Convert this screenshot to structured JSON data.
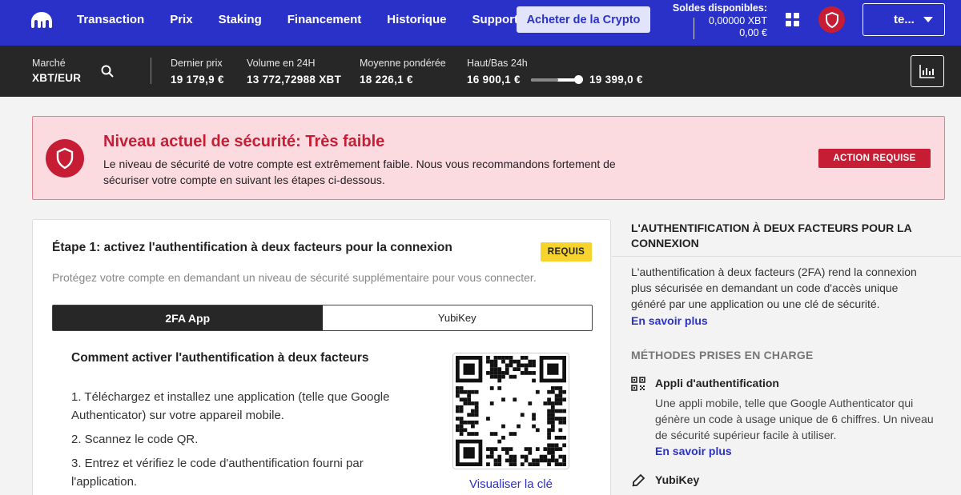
{
  "nav": {
    "links": [
      "Transaction",
      "Prix",
      "Staking",
      "Financement",
      "Historique",
      "Support"
    ],
    "buy_button": "Acheter de la Crypto",
    "balances_title": "Soldes disponibles:",
    "balance_xbt": "0,00000 XBT",
    "balance_eur": "0,00 €",
    "account_label": "te...",
    "brand_color": "#2a31c9"
  },
  "ticker": {
    "market_label": "Marché",
    "market_value": "XBT/EUR",
    "last_price_label": "Dernier prix",
    "last_price_value": "19 179,9 €",
    "volume_label": "Volume en 24H",
    "volume_value": "13 772,72988 XBT",
    "avg_label": "Moyenne pondérée",
    "avg_value": "18 226,1 €",
    "range_label": "Haut/Bas 24h",
    "range_low": "16 900,1 €",
    "range_high": "19 399,0 €",
    "range_position": 0.9
  },
  "alert": {
    "title": "Niveau actuel de sécurité: Très faible",
    "text": "Le niveau de sécurité de votre compte est extrêmement faible. Nous vous recommandons fortement de sécuriser votre compte en suivant les étapes ci-dessous.",
    "badge": "ACTION REQUISE",
    "color": "#c61d35"
  },
  "step": {
    "title": "Étape 1: activez l'authentification à deux facteurs pour la connexion",
    "badge": "REQUIS",
    "subtitle": "Protégez votre compte en demandant un niveau de sécurité supplémentaire pour vous connecter.",
    "tabs": [
      "2FA App",
      "YubiKey"
    ],
    "howto_title": "Comment activer l'authentification à deux facteurs",
    "howto_steps": [
      "1. Téléchargez et installez une application (telle que Google Authenticator) sur votre appareil mobile.",
      "2. Scannez le code QR.",
      "3. Entrez et vérifiez le code d'authentification fourni par l'application."
    ],
    "qr_link": "Visualiser la clé"
  },
  "side": {
    "heading": "L'AUTHENTIFICATION À DEUX FACTEURS POUR LA CONNEXION",
    "text": "L'authentification à deux facteurs (2FA) rend la connexion plus sécurisée en demandant un code d'accès unique généré par une application ou une clé de sécurité.",
    "learn_more": "En savoir plus",
    "methods_title": "MÉTHODES PRISES EN CHARGE",
    "method1_title": "Appli d'authentification",
    "method1_text": "Une appli mobile, telle que Google Authenticator qui génère un code à usage unique de 6 chiffres. Un niveau de sécurité supérieur facile à utiliser.",
    "method1_link": "En savoir plus",
    "method2_title": "YubiKey"
  }
}
